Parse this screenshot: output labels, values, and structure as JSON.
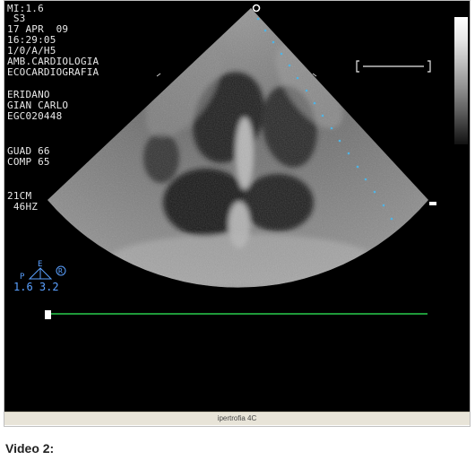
{
  "overlay": {
    "lines": [
      "MI:1.6",
      " S3",
      "17 APR  09",
      "16:29:05",
      "1/0/A/H5",
      "AMB.CARDIOLOGIA",
      "ECOCARDIOGRAFIA"
    ],
    "patient": [
      "ERIDANO",
      "GIAN CARLO",
      "EGC020448"
    ],
    "gain": [
      "GUAD 66",
      "COMP 65"
    ],
    "depth": [
      "21CM",
      " 46HZ"
    ]
  },
  "indicator": {
    "letters": [
      "P",
      "E",
      "R"
    ],
    "numbers": "1.6 3.2",
    "color": "#5aa0ff"
  },
  "colors": {
    "screen_bg": "#000000",
    "ecg_trace": "#1f9a3a",
    "caption_bg": "#e8e4d8",
    "depth_dots": "#4fb4e6"
  },
  "caption": "ipertrofia 4C",
  "video_label": "Video 2:"
}
